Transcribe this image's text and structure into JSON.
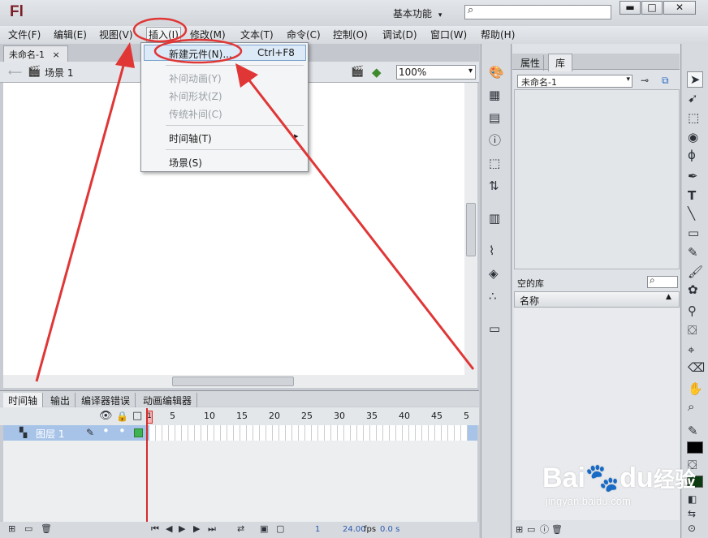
{
  "app": {
    "logo": "Fl",
    "workspace": "基本功能",
    "workspace_caret": "▾",
    "search_icon": "⌕"
  },
  "window_controls": {
    "minimize": "▬",
    "maximize": "□",
    "close": "✕"
  },
  "menubar": {
    "items": [
      "文件(F)",
      "编辑(E)",
      "视图(V)",
      "插入(I)",
      "修改(M)",
      "文本(T)",
      "命令(C)",
      "控制(O)",
      "调试(D)",
      "窗口(W)",
      "帮助(H)"
    ]
  },
  "insert_menu": {
    "items": [
      {
        "label": "新建元件(N)...",
        "shortcut": "Ctrl+F8",
        "enabled": true,
        "highlighted": true
      },
      {
        "label": "补间动画(Y)",
        "enabled": false
      },
      {
        "label": "补间形状(Z)",
        "enabled": false
      },
      {
        "label": "传统补间(C)",
        "enabled": false
      },
      {
        "label": "时间轴(T)",
        "enabled": true,
        "submenu": "▸"
      },
      {
        "label": "场景(S)",
        "enabled": true
      }
    ]
  },
  "document": {
    "tab": "未命名-1",
    "tab_close": "×",
    "scene": "场景 1",
    "zoom": "100%",
    "zoom_caret": "▾"
  },
  "timeline": {
    "tabs": [
      "时间轴",
      "输出",
      "编译器错误",
      "动画编辑器"
    ],
    "frame_numbers": [
      "1",
      "5",
      "10",
      "15",
      "20",
      "25",
      "30",
      "35",
      "40",
      "45",
      "5"
    ],
    "layer": "图层 1",
    "footer": {
      "frame": "1",
      "fps": "24.00",
      "fps_unit": "fps",
      "time": "0.0 s"
    }
  },
  "library": {
    "tabs": [
      "属性",
      "库"
    ],
    "document": "未命名-1",
    "empty_label": "空的库",
    "name_header": "名称",
    "search_icon": "⌕"
  },
  "watermark": {
    "brand": "Bai",
    "brand2": "du",
    "brand3": "经验",
    "url": "jingyan.baidu.com"
  },
  "colors": {
    "accent_red": "#e03636",
    "frame_current": "#d62a2a"
  }
}
